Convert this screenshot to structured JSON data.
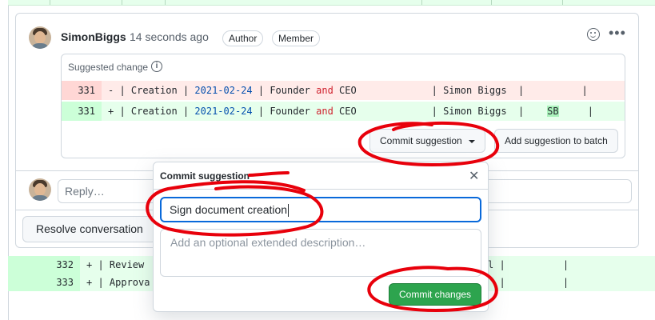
{
  "comment": {
    "author": "SimonBiggs",
    "timestamp": "14 seconds ago",
    "badges": [
      "Author",
      "Member"
    ],
    "icons": {
      "reaction": "smiley-icon",
      "menu": "kebab-horizontal-icon"
    }
  },
  "suggestion": {
    "header": "Suggested change",
    "info_icon": "info-icon",
    "rows": [
      {
        "type": "deletion",
        "line": "331",
        "sign": "-",
        "pre": " | Creation | ",
        "date": "2021-02-24",
        "mid": " | Founder ",
        "kw": "and",
        "post": " CEO             | Simon Biggs  |          |"
      },
      {
        "type": "addition",
        "line": "331",
        "sign": "+",
        "pre": " | Creation | ",
        "date": "2021-02-24",
        "mid": " | Founder ",
        "kw": "and",
        "post": " CEO             | Simon Biggs  |    ",
        "initials": "SB",
        "end": "     |"
      }
    ],
    "commit_button": "Commit suggestion",
    "batch_button": "Add suggestion to batch"
  },
  "reply": {
    "placeholder": "Reply…"
  },
  "resolve_button": "Resolve conversation",
  "diff_below": [
    {
      "line": "332",
      "sign": "+",
      "code": " | Review",
      "tail": "l |          |"
    },
    {
      "line": "333",
      "sign": "+",
      "code": " | Approva",
      "tail": "  |          |"
    }
  ],
  "popover": {
    "title": "Commit suggestion",
    "close_icon": "close-icon",
    "title_value": "Sign document creation",
    "description_placeholder": "Add an optional extended description…",
    "submit_button": "Commit changes"
  },
  "colors": {
    "annotation_red": "#e8000b",
    "primary_green": "#2da44e",
    "focus_blue": "#0969da"
  }
}
